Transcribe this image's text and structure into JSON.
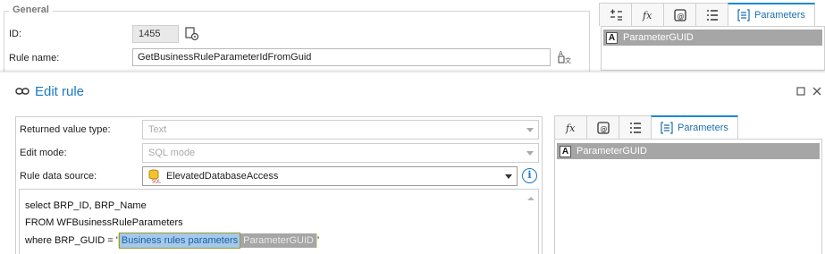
{
  "background_window": {
    "group_title": "General",
    "id_label": "ID:",
    "id_value": "1455",
    "rule_name_label": "Rule name:",
    "rule_name_value": "GetBusinessRuleParameterIdFromGuid",
    "tabs": {
      "operators_icon": "plus-minus-equals-icon",
      "functions_icon": "fx-icon",
      "variables_icon": "at-sign-icon",
      "list_icon": "list-icon",
      "parameters_label": "Parameters"
    },
    "parameters": [
      {
        "type_badge": "A",
        "name": "ParameterGUID"
      }
    ]
  },
  "dialog": {
    "title": "Edit rule",
    "title_icon": "link-icon",
    "maximize_icon": "maximize-icon",
    "close_icon": "close-icon",
    "returned_value_type_label": "Returned value type:",
    "returned_value_type_value": "Text",
    "edit_mode_label": "Edit mode:",
    "edit_mode_value": "SQL mode",
    "data_source_label": "Rule data source:",
    "data_source_value": "ElevatedDatabaseAccess",
    "code": {
      "line1": "select BRP_ID, BRP_Name",
      "line2": "FROM  WFBusinessRuleParameters",
      "line3_prefix": "where BRP_GUID = '",
      "token_group": "Business rules parameters",
      "token_param": "ParameterGUID",
      "line3_suffix": "'"
    },
    "tabs": {
      "functions_icon": "fx-icon",
      "variables_icon": "at-sign-icon",
      "list_icon": "list-icon",
      "parameters_label": "Parameters"
    },
    "parameters": [
      {
        "type_badge": "A",
        "name": "ParameterGUID"
      }
    ]
  },
  "colors": {
    "accent": "#1b78c4",
    "selection_gray": "#a6a6a6",
    "token_blue": "#a5c9e8",
    "token_highlight": "#dfe28b"
  }
}
